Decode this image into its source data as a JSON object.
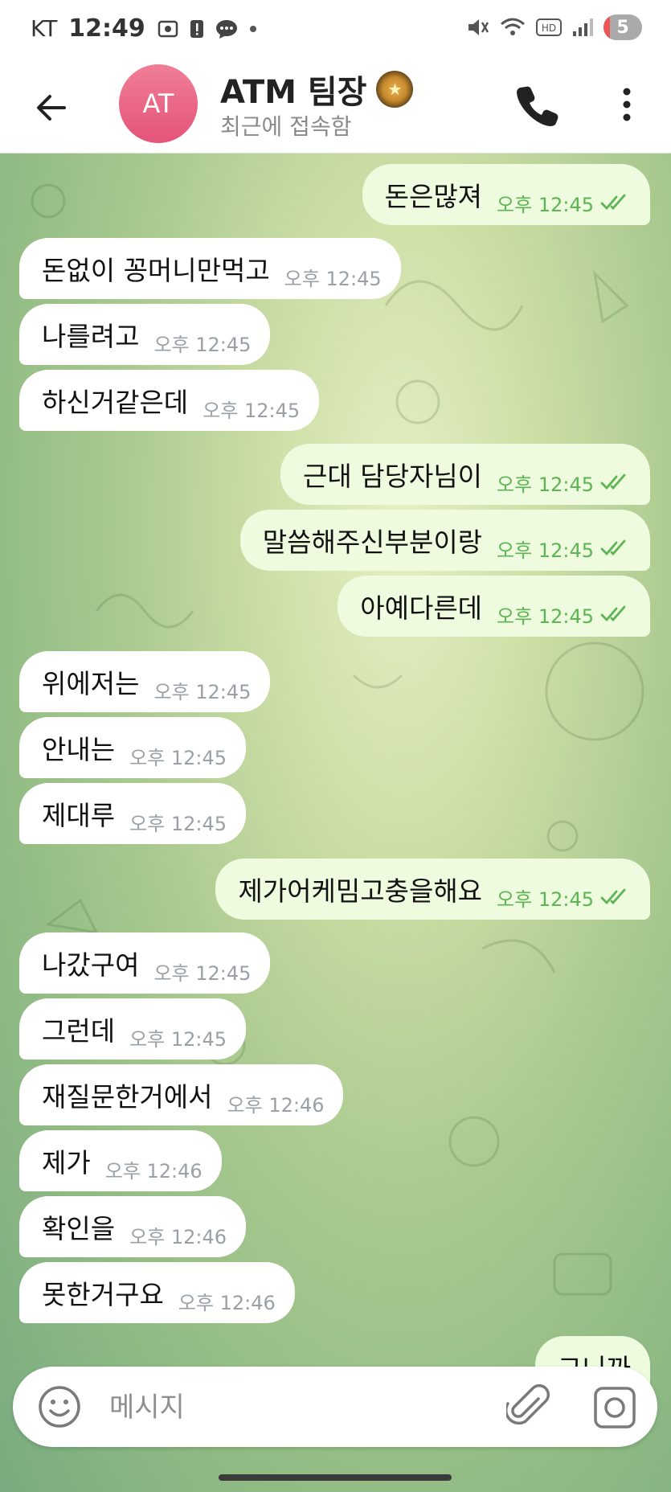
{
  "status_bar": {
    "carrier": "KT",
    "time": "12:49",
    "battery_level": "5"
  },
  "header": {
    "avatar_initials": "AT",
    "title": "ATM 팀장",
    "subtitle": "최근에 접속함"
  },
  "messages": [
    {
      "dir": "out",
      "text": "돈은많져",
      "time": "오후 12:45"
    },
    {
      "dir": "in",
      "text": "돈없이 꽁머니만먹고",
      "time": "오후 12:45"
    },
    {
      "dir": "in",
      "text": "나를려고",
      "time": "오후 12:45"
    },
    {
      "dir": "in",
      "text": "하신거같은데",
      "time": "오후 12:45"
    },
    {
      "dir": "out",
      "text": "근대 담당자님이",
      "time": "오후 12:45"
    },
    {
      "dir": "out",
      "text": "말씀해주신부분이랑",
      "time": "오후 12:45"
    },
    {
      "dir": "out",
      "text": "아예다른데",
      "time": "오후 12:45"
    },
    {
      "dir": "in",
      "text": "위에저는",
      "time": "오후 12:45"
    },
    {
      "dir": "in",
      "text": "안내는",
      "time": "오후 12:45"
    },
    {
      "dir": "in",
      "text": "제대루",
      "time": "오후 12:45"
    },
    {
      "dir": "out",
      "text": "제가어케밈고충을해요",
      "time": "오후 12:45"
    },
    {
      "dir": "in",
      "text": "나갔구여",
      "time": "오후 12:45"
    },
    {
      "dir": "in",
      "text": "그런데",
      "time": "오후 12:45"
    },
    {
      "dir": "in",
      "text": "재질문한거에서",
      "time": "오후 12:46"
    },
    {
      "dir": "in",
      "text": "제가",
      "time": "오후 12:46"
    },
    {
      "dir": "in",
      "text": "확인을",
      "time": "오후 12:46"
    },
    {
      "dir": "in",
      "text": "못한거구요",
      "time": "오후 12:46"
    },
    {
      "dir": "out",
      "text": "그니까",
      "time": ""
    }
  ],
  "input": {
    "placeholder": "메시지"
  },
  "colors": {
    "outgoing_bubble": "#eefbdf",
    "incoming_bubble": "#ffffff",
    "outgoing_time": "#5cb452",
    "avatar": "#e96a88"
  }
}
